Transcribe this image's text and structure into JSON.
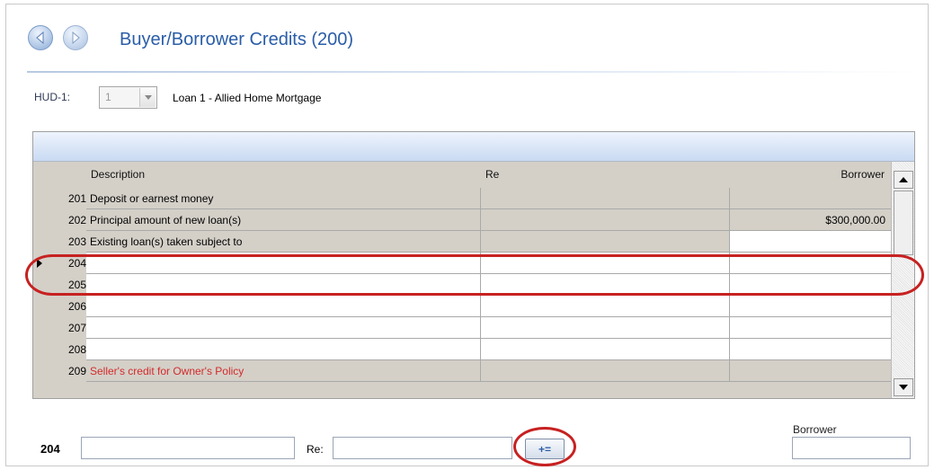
{
  "header": {
    "title": "Buyer/Borrower Credits (200)",
    "back_icon": "back-arrow-icon",
    "forward_icon": "forward-arrow-icon"
  },
  "hud": {
    "label": "HUD-1:",
    "selected": "1",
    "loan_label": "Loan 1 - Allied Home Mortgage"
  },
  "grid": {
    "columns": {
      "description": "Description",
      "re": "Re",
      "borrower": "Borrower"
    },
    "rows": [
      {
        "num": "201",
        "description": "Deposit or earnest money",
        "re": "",
        "borrower": ""
      },
      {
        "num": "202",
        "description": "Principal amount of new loan(s)",
        "re": "",
        "borrower": "$300,000.00"
      },
      {
        "num": "203",
        "description": "Existing loan(s) taken subject to",
        "re": "",
        "borrower": ""
      },
      {
        "num": "204",
        "description": "",
        "re": "",
        "borrower": ""
      },
      {
        "num": "205",
        "description": "",
        "re": "",
        "borrower": ""
      },
      {
        "num": "206",
        "description": "",
        "re": "",
        "borrower": ""
      },
      {
        "num": "207",
        "description": "",
        "re": "",
        "borrower": ""
      },
      {
        "num": "208",
        "description": "",
        "re": "",
        "borrower": ""
      },
      {
        "num": "209",
        "description": "Seller's credit for Owner's Policy",
        "re": "",
        "borrower": ""
      }
    ],
    "selected_row": "204"
  },
  "form": {
    "line_number": "204",
    "description_value": "",
    "re_label": "Re:",
    "re_value": "",
    "add_button_label": "+=",
    "borrower_label": "Borrower",
    "borrower_value": ""
  },
  "colors": {
    "title": "#2a5da8",
    "highlight": "#c72121",
    "red_text": "#d22b2b",
    "grid_bg": "#d4d0c8"
  }
}
